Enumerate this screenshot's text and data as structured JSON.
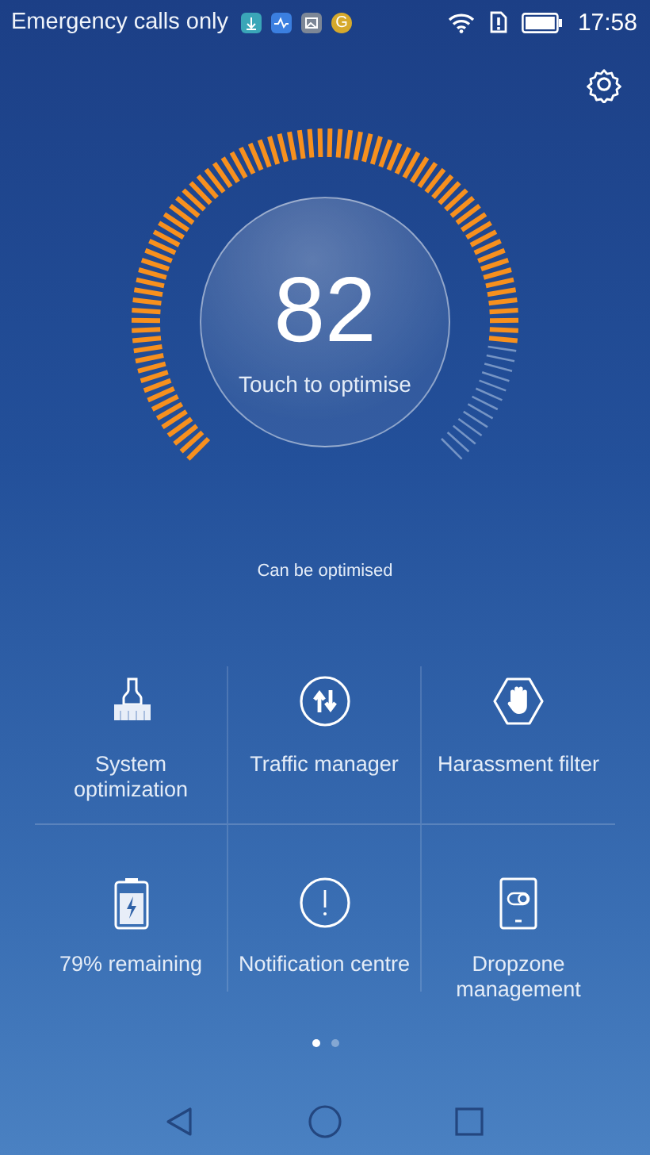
{
  "status_bar": {
    "carrier": "Emergency calls only",
    "notification_letter": "G",
    "time": "17:58"
  },
  "gauge": {
    "score": "82",
    "action": "Touch to optimise"
  },
  "status_text": "Can be optimised",
  "tools": [
    {
      "label": "System optimization",
      "kind": "brush"
    },
    {
      "label": "Traffic manager",
      "kind": "traffic"
    },
    {
      "label": "Harassment filter",
      "kind": "hand"
    },
    {
      "label": "79% remaining",
      "kind": "battery"
    },
    {
      "label": "Notification centre",
      "kind": "alert"
    },
    {
      "label": "Dropzone management",
      "kind": "dropzone"
    }
  ],
  "pages": [
    {
      "selected": true
    },
    {
      "selected": false
    }
  ]
}
